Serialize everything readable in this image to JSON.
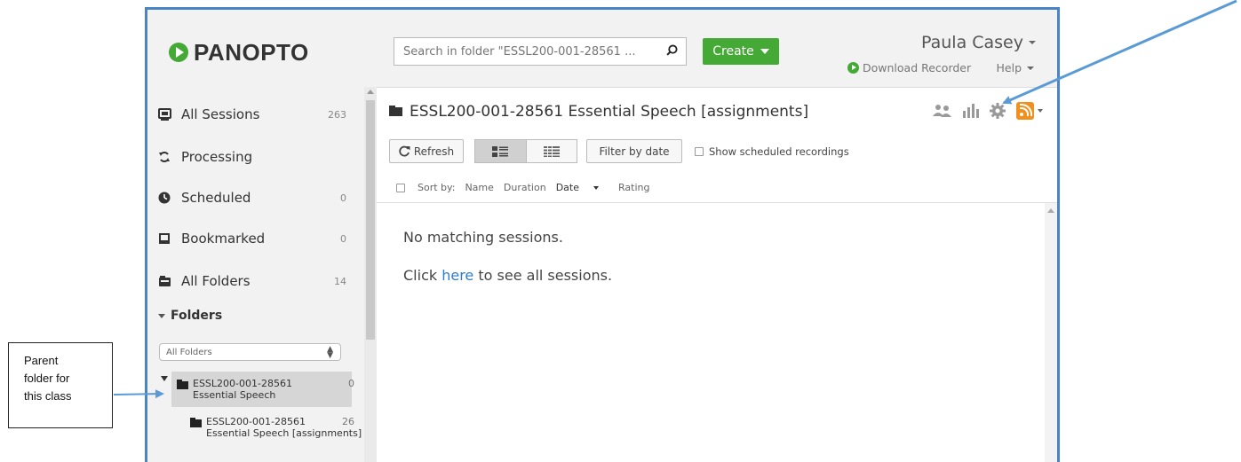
{
  "header": {
    "logo_text": "PANOPTO",
    "search_placeholder": "Search in folder \"ESSL200-001-28561 ...",
    "create_label": "Create",
    "user_name": "Paula Casey",
    "download_recorder": "Download Recorder",
    "help": "Help"
  },
  "sidebar": {
    "items": [
      {
        "label": "All Sessions",
        "count": "263",
        "icon": "sessions-icon"
      },
      {
        "label": "Processing",
        "count": "",
        "icon": "processing-icon"
      },
      {
        "label": "Scheduled",
        "count": "0",
        "icon": "clock-icon"
      },
      {
        "label": "Bookmarked",
        "count": "0",
        "icon": "bookmark-icon"
      },
      {
        "label": "All Folders",
        "count": "14",
        "icon": "folders-icon"
      }
    ],
    "folders_heading": "Folders",
    "folder_filter": "All Folders",
    "tree": [
      {
        "line1": "ESSL200-001-28561",
        "line2": "Essential Speech",
        "count": "0"
      },
      {
        "line1": "ESSL200-001-28561",
        "line2": "Essential Speech [assignments]",
        "count": "26"
      }
    ]
  },
  "main": {
    "folder_title": "ESSL200-001-28561 Essential Speech [assignments]",
    "refresh_label": "Refresh",
    "filter_by_date": "Filter by date",
    "show_scheduled": "Show scheduled recordings",
    "sort_by": "Sort by:",
    "sort_options": [
      "Name",
      "Duration",
      "Date",
      "Rating"
    ],
    "no_match": "No matching sessions.",
    "click_prefix": "Click",
    "click_link": "here",
    "click_suffix": "to see all sessions."
  },
  "annotation": {
    "callout_lines": [
      "Parent",
      "folder for",
      "this class"
    ]
  },
  "colors": {
    "brand_green": "#45a935",
    "rss_orange": "#f0901e",
    "link_blue": "#2f7ec6",
    "arrow_blue": "#5b9bd5"
  }
}
